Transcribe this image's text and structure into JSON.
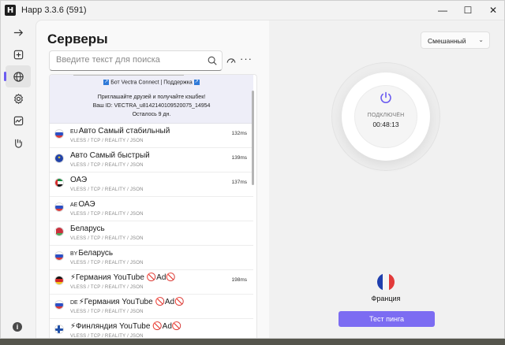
{
  "window": {
    "title": "Happ 3.3.6 (591)",
    "app_icon_letter": "H"
  },
  "controls": {
    "minimize": "—",
    "maximize": "☐",
    "close": "✕"
  },
  "sidebar": {
    "items": [
      {
        "name": "arrow-right-icon"
      },
      {
        "name": "add-square-icon"
      },
      {
        "name": "globe-icon",
        "active": true
      },
      {
        "name": "gear-icon"
      },
      {
        "name": "stats-icon"
      },
      {
        "name": "hand-icon"
      }
    ],
    "info_label": "i"
  },
  "servers": {
    "title": "Серверы",
    "search_placeholder": "Введите текст для поиска",
    "more_label": "···",
    "promo": {
      "bot_line": "Бот Vectra Connect | Поддержка",
      "invite_line": "Приглашайте друзей и получайте кэшбек!",
      "id_line": "Ваш ID: VECTRA_u8142140109520075_14954",
      "days_line": "Осталось 9 дн."
    },
    "rows": [
      {
        "flag": "ru",
        "code": "EU",
        "name": "Авто Самый стабильный",
        "sub": "VLESS / TCP / REALITY / JSON",
        "ping": "132ms"
      },
      {
        "flag": "eu",
        "code": "",
        "name": "Авто Самый быстрый",
        "sub": "VLESS / TCP / REALITY / JSON",
        "ping": "139ms"
      },
      {
        "flag": "ae",
        "code": "",
        "name": "ОАЭ",
        "sub": "VLESS / TCP / REALITY / JSON",
        "ping": "137ms"
      },
      {
        "flag": "ru",
        "code": "AE",
        "name": "ОАЭ",
        "sub": "VLESS / TCP / REALITY / JSON",
        "ping": ""
      },
      {
        "flag": "by",
        "code": "",
        "name": "Беларусь",
        "sub": "VLESS / TCP / REALITY / JSON",
        "ping": ""
      },
      {
        "flag": "ru",
        "code": "BY",
        "name": "Беларусь",
        "sub": "VLESS / TCP / REALITY / JSON",
        "ping": ""
      },
      {
        "flag": "de",
        "code": "",
        "name": "⚡Германия YouTube 🚫Ad🚫",
        "sub": "VLESS / TCP / REALITY / JSON",
        "ping": "198ms"
      },
      {
        "flag": "ru",
        "code": "DE",
        "name": "⚡Германия YouTube 🚫Ad🚫",
        "sub": "VLESS / TCP / REALITY / JSON",
        "ping": ""
      },
      {
        "flag": "fi",
        "code": "",
        "name": "⚡Финляндия YouTube 🚫Ad🚫",
        "sub": "VLESS / TCP / REALITY / JSON",
        "ping": ""
      }
    ]
  },
  "connection": {
    "mode": "Смешанный",
    "status": "ПОДКЛЮЧЁН",
    "time": "00:48:13",
    "country": "Франция",
    "ping_button": "Тест пинга"
  },
  "colors": {
    "accent": "#7c6cf2",
    "power": "#6b5cf0"
  }
}
